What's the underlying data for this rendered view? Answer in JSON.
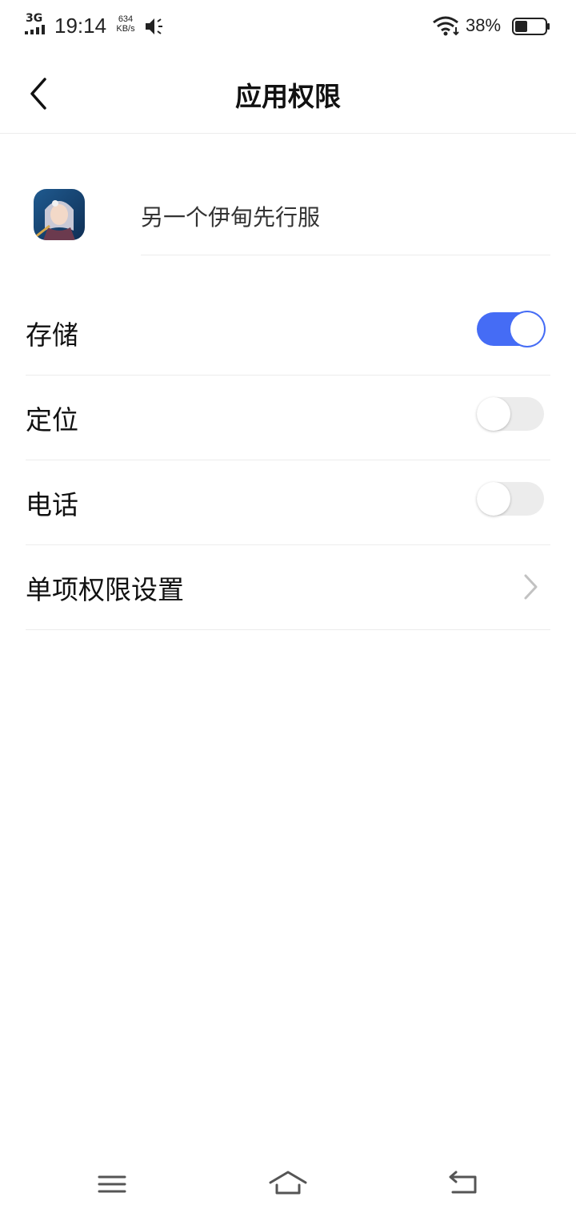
{
  "status_bar": {
    "network": "3G",
    "time": "19:14",
    "speed_value": "634",
    "speed_unit": "KB/s",
    "battery_percent": "38%",
    "icons": [
      "signal-icon",
      "speaker-icon",
      "wifi-icon",
      "battery-icon"
    ]
  },
  "header": {
    "title": "应用权限",
    "back_icon": "chevron-left-icon"
  },
  "app": {
    "name": "另一个伊甸先行服"
  },
  "permissions": [
    {
      "label": "存储",
      "enabled": true
    },
    {
      "label": "定位",
      "enabled": false
    },
    {
      "label": "电话",
      "enabled": false
    }
  ],
  "single_permission": {
    "label": "单项权限设置",
    "icon": "chevron-right-icon"
  },
  "nav": {
    "icons": [
      "menu-icon",
      "home-icon",
      "back-icon"
    ]
  },
  "colors": {
    "accent": "#456cf5",
    "divider": "#ececec",
    "toggle_off": "#ececec"
  }
}
